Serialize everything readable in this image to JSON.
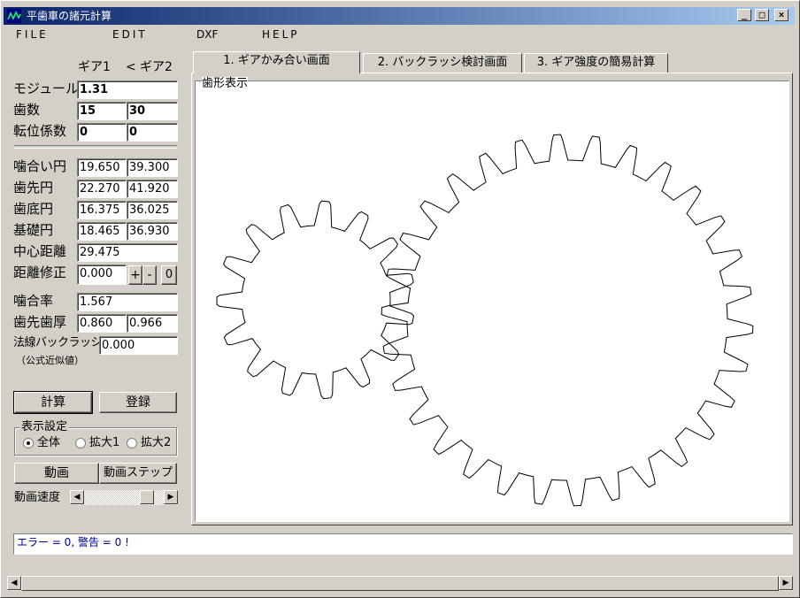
{
  "window": {
    "title": "平歯車の諸元計算",
    "controls": {
      "minimize": "_",
      "maximize": "□",
      "close": "×"
    }
  },
  "menu": [
    "FILE",
    "EDIT",
    "DXF",
    "HELP"
  ],
  "gear_header": {
    "gear1": "ギア1",
    "arrow": "<",
    "gear2": "ギア2"
  },
  "inputs": [
    {
      "label": "モジュール",
      "value": "1.31"
    },
    {
      "label": "歯数",
      "gear1": "15",
      "gear2": "30"
    },
    {
      "label": "転位係数",
      "gear1": "0",
      "gear2": "0"
    }
  ],
  "results": [
    {
      "label": "噛合い円",
      "gear1": "19.650",
      "gear2": "39.300"
    },
    {
      "label": "歯先円",
      "gear1": "22.270",
      "gear2": "41.920"
    },
    {
      "label": "歯底円",
      "gear1": "16.375",
      "gear2": "36.025"
    },
    {
      "label": "基礎円",
      "gear1": "18.465",
      "gear2": "36.930"
    }
  ],
  "center_distance": {
    "label": "中心距離",
    "value": "29.475"
  },
  "distance_correction": {
    "label": "距離修正",
    "value": "0.000",
    "plus": "+",
    "minus": "-",
    "zero": "0"
  },
  "contact_ratio": {
    "label": "噛合率",
    "value": "1.567"
  },
  "tip_thickness": {
    "label": "歯先歯厚",
    "gear1": "0.860",
    "gear2": "0.966"
  },
  "backlash": {
    "label": "法線バックラッシ",
    "note": "（公式近似値）",
    "value": "0.000"
  },
  "buttons": {
    "calc": "計算",
    "register": "登録",
    "anim": "動画",
    "anim_step": "動画ステップ"
  },
  "display": {
    "title": "表示設定",
    "options": [
      {
        "label": "全体",
        "selected": true
      },
      {
        "label": "拡大1",
        "selected": false
      },
      {
        "label": "拡大2",
        "selected": false
      }
    ]
  },
  "speed": {
    "label": "動画速度",
    "level": 0.85
  },
  "tabs": [
    {
      "label": "1. ギアかみ合い画面",
      "active": true
    },
    {
      "label": "2. バックラッシ検討画面",
      "active": false
    },
    {
      "label": "3. ギア強度の簡易計算",
      "active": false
    }
  ],
  "canvas": {
    "title": "歯形表示"
  },
  "status": "エラー = 0, 警告 = 0 !",
  "colors": {
    "title_start": "#0a246a",
    "title_end": "#a6caf0",
    "status_text": "#0000a0",
    "gear_stroke": "#000000"
  }
}
